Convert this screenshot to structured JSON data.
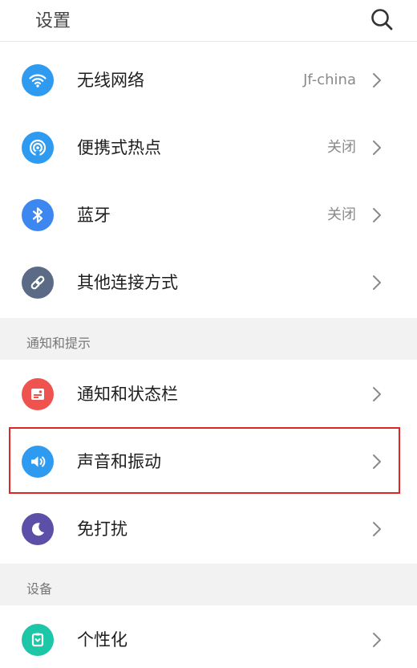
{
  "header": {
    "title": "设置",
    "search_icon": "search-icon"
  },
  "rows": [
    {
      "label": "无线网络",
      "value": "Jf-china",
      "icon": "wifi-icon",
      "color": "#2E9BF0"
    },
    {
      "label": "便携式热点",
      "value": "关闭",
      "icon": "hotspot-icon",
      "color": "#2E9BF0"
    },
    {
      "label": "蓝牙",
      "value": "关闭",
      "icon": "bluetooth-icon",
      "color": "#3D87F0"
    },
    {
      "label": "其他连接方式",
      "value": "",
      "icon": "link-icon",
      "color": "#5B6B86"
    },
    {
      "label": "通知和状态栏",
      "value": "",
      "icon": "notification-icon",
      "color": "#EF5350"
    },
    {
      "label": "声音和振动",
      "value": "",
      "icon": "speaker-icon",
      "color": "#2E9BF0"
    },
    {
      "label": "免打扰",
      "value": "",
      "icon": "moon-icon",
      "color": "#5B4FA8"
    },
    {
      "label": "个性化",
      "value": "",
      "icon": "theme-icon",
      "color": "#1EC6A8"
    }
  ],
  "sections": {
    "notifications": "通知和提示",
    "device": "设备"
  },
  "highlight_color": "#E02525"
}
